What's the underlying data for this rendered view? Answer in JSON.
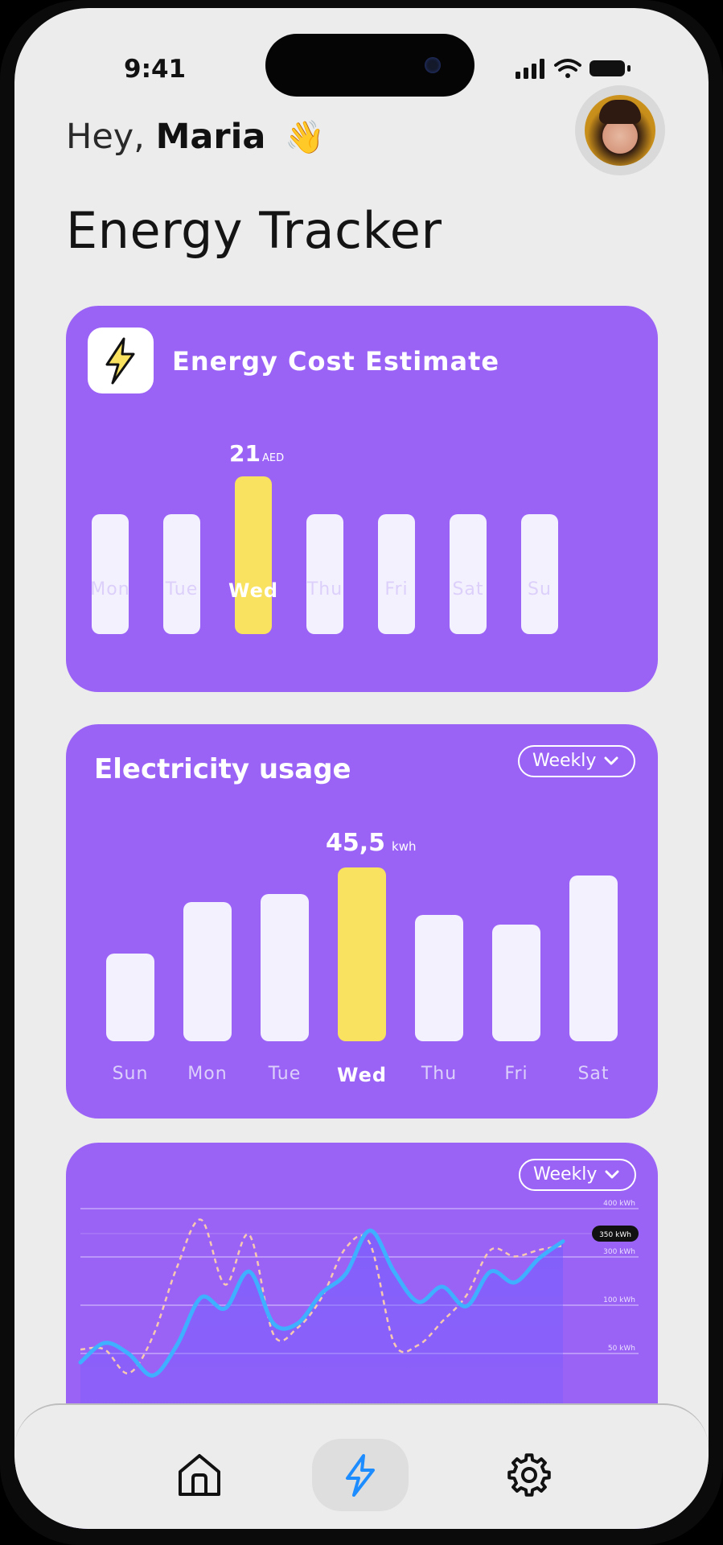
{
  "status_bar": {
    "time": "9:41"
  },
  "header": {
    "greeting_prefix": "Hey,",
    "user_name": "Maria",
    "greeting_emoji": "👋",
    "title": "Energy Tracker"
  },
  "cost_card": {
    "title": "Energy Cost Estimate",
    "icon": "bolt-icon",
    "highlight_value": "21",
    "highlight_unit": "AED",
    "days": [
      "Mon",
      "Tue",
      "Wed",
      "Thu",
      "Fri",
      "Sat",
      "Su"
    ],
    "highlighted_index": 2,
    "accent_color": "#9a63f6",
    "highlight_color": "#f9e25f"
  },
  "usage_card": {
    "title": "Electricity usage",
    "dropdown_value": "Weekly",
    "highlight_value": "45,5",
    "highlight_unit": "kwh",
    "days": [
      "Sun",
      "Mon",
      "Tue",
      "Wed",
      "Thu",
      "Fri",
      "Sat"
    ],
    "highlighted_index": 3
  },
  "trend_card": {
    "dropdown_value": "Weekly",
    "y_tick_labels": [
      "400 kWh",
      "350 kWh",
      "300 kWh",
      "100 kWh",
      "50 kWh"
    ],
    "highlight_tick": "350 kWh"
  },
  "chart_data": [
    {
      "type": "bar",
      "title": "Energy Cost Estimate",
      "categories": [
        "Mon",
        "Tue",
        "Wed",
        "Thu",
        "Fri",
        "Sat",
        "Su"
      ],
      "values": [
        16,
        16,
        21,
        16,
        16,
        16,
        16
      ],
      "unit": "AED",
      "ylim": [
        0,
        22
      ]
    },
    {
      "type": "bar",
      "title": "Electricity usage",
      "categories": [
        "Sun",
        "Mon",
        "Tue",
        "Wed",
        "Thu",
        "Fri",
        "Sat"
      ],
      "values": [
        23,
        36.5,
        38.5,
        45.5,
        33,
        30.5,
        43.5
      ],
      "unit": "kwh",
      "ylim": [
        0,
        47
      ]
    },
    {
      "type": "line",
      "legend": "none",
      "ylim": [
        0,
        420
      ],
      "y_ticks": [
        "400 kWh",
        "350 kWh",
        "300 kWh",
        "100 kWh",
        "50 kWh"
      ],
      "x": [
        0,
        1,
        2,
        3,
        4,
        5,
        6,
        7,
        8,
        9,
        10,
        11,
        12,
        13,
        14,
        15,
        16,
        17,
        18,
        19,
        20
      ],
      "series": [
        {
          "values": [
            50,
            95,
            70,
            20,
            90,
            200,
            175,
            260,
            140,
            140,
            210,
            255,
            355,
            260,
            190,
            225,
            180,
            260,
            235,
            290,
            330
          ],
          "style": "solid-blue"
        },
        {
          "values": [
            80,
            80,
            25,
            110,
            270,
            380,
            230,
            345,
            115,
            130,
            200,
            315,
            325,
            95,
            90,
            145,
            205,
            310,
            295,
            310,
            320
          ],
          "style": "dashed-peach"
        }
      ]
    }
  ]
}
